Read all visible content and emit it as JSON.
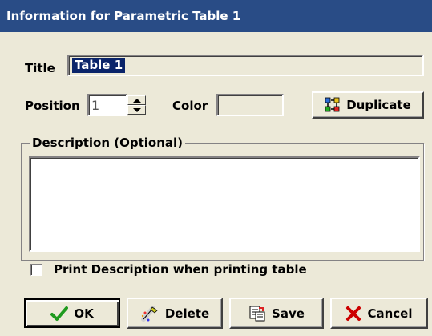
{
  "window": {
    "title": "Information for Parametric Table 1"
  },
  "form": {
    "title_label": "Title",
    "title_value": "Table 1",
    "position_label": "Position",
    "position_value": "1",
    "color_label": "Color",
    "duplicate_label": "Duplicate",
    "description_label": "Description (Optional)",
    "description_value": "",
    "print_description_label": "Print Description when printing table",
    "print_description_checked": false
  },
  "buttons": {
    "ok": "OK",
    "delete": "Delete",
    "save": "Save",
    "cancel": "Cancel"
  },
  "colors": {
    "titlebar": "#294c86",
    "selection": "#0a246a",
    "face": "#ece9d8",
    "ok_check": "#1f9a1f",
    "cancel_x": "#cc0000"
  },
  "icons": [
    "duplicate-icon",
    "check-icon",
    "delete-icon",
    "save-icon",
    "cancel-x-icon",
    "spin-up-icon",
    "spin-down-icon"
  ]
}
